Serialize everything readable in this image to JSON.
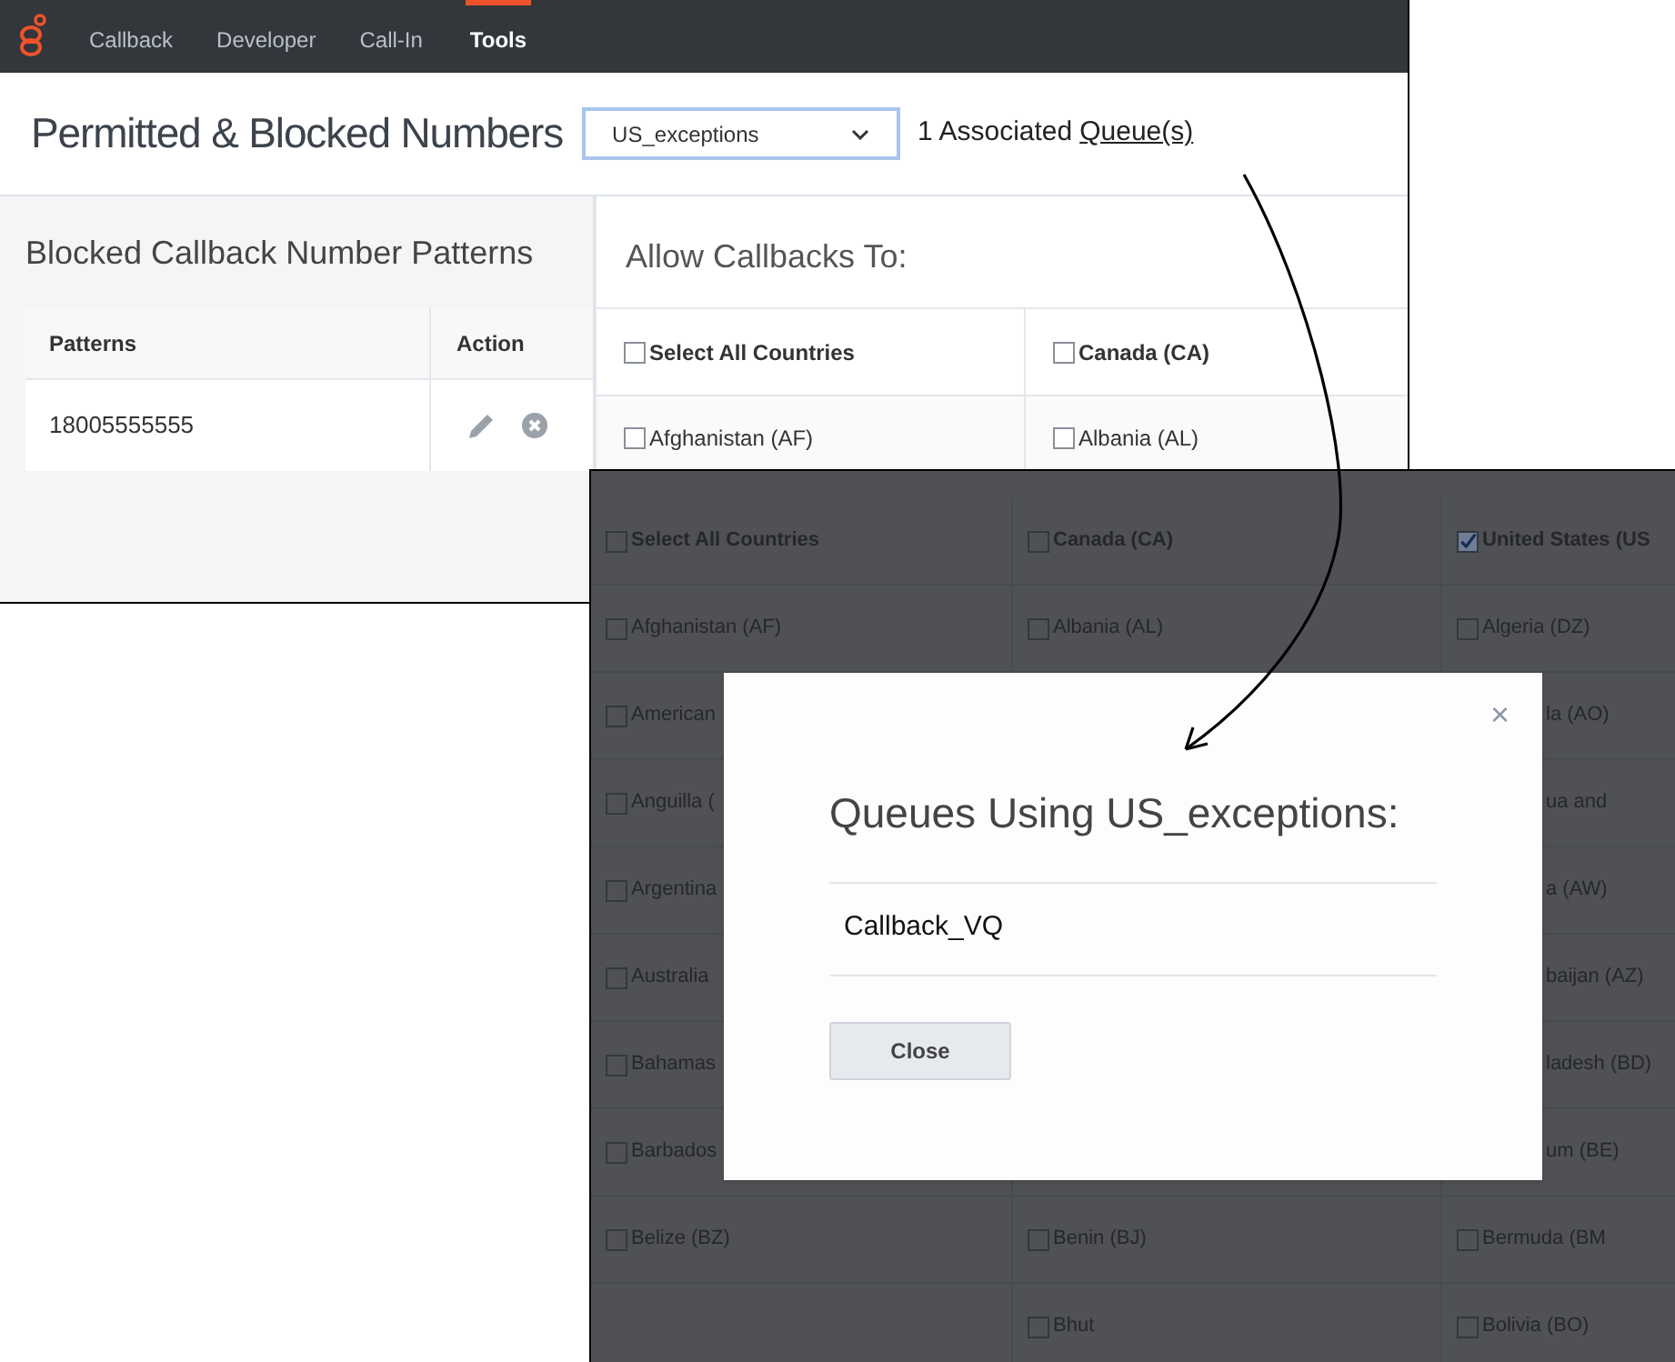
{
  "nav": {
    "items": [
      {
        "label": "Callback",
        "selected": false
      },
      {
        "label": "Developer",
        "selected": false
      },
      {
        "label": "Call-In",
        "selected": false
      },
      {
        "label": "Tools",
        "selected": true
      }
    ]
  },
  "header": {
    "title": "Permitted & Blocked Numbers",
    "dropdown": {
      "value": "US_exceptions"
    },
    "associated": "1 Associated",
    "queues_link": "Queue(s)"
  },
  "blocked": {
    "title": "Blocked Callback Number Patterns",
    "columns": [
      "Patterns",
      "Action"
    ],
    "rows": [
      {
        "pattern": "18005555555"
      }
    ]
  },
  "allow": {
    "title": "Allow Callbacks To:",
    "header": [
      {
        "label": "Select All Countries",
        "checked": false
      },
      {
        "label": "Canada (CA)",
        "checked": false
      }
    ],
    "rows": [
      [
        {
          "label": "Afghanistan (AF)",
          "checked": false
        },
        {
          "label": "Albania (AL)",
          "checked": false
        }
      ]
    ]
  },
  "overlay_grid": {
    "header": [
      {
        "label": "Select All Countries",
        "checked": false
      },
      {
        "label": "Canada (CA)",
        "checked": false
      },
      {
        "label": "United States (US",
        "checked": true
      }
    ],
    "rows": [
      [
        {
          "label": "Afghanistan (AF)",
          "checked": false
        },
        {
          "label": "Albania (AL)",
          "checked": false
        },
        {
          "label": "Algeria (DZ)",
          "checked": false
        }
      ],
      [
        {
          "label": "American",
          "checked": false
        },
        null,
        {
          "label": "la (AO)"
        }
      ],
      [
        {
          "label": "Anguilla (",
          "checked": false
        },
        null,
        {
          "label": "ua and"
        }
      ],
      [
        {
          "label": "Argentina",
          "checked": false
        },
        null,
        {
          "label": "a (AW)"
        }
      ],
      [
        {
          "label": "Australia",
          "checked": false
        },
        null,
        {
          "label": "baijan (AZ)"
        }
      ],
      [
        {
          "label": "Bahamas",
          "checked": false
        },
        null,
        {
          "label": "ladesh (BD)"
        }
      ],
      [
        {
          "label": "Barbados",
          "checked": false
        },
        null,
        {
          "label": "um (BE)"
        }
      ],
      [
        {
          "label": "Belize (BZ)",
          "checked": false
        },
        {
          "label": "Benin (BJ)",
          "checked": false
        },
        {
          "label": "Bermuda (BM",
          "checked": false
        }
      ],
      [
        null,
        {
          "label": "Bhut",
          "checked": false
        },
        {
          "label": "Bolivia (BO)",
          "checked": false
        }
      ]
    ]
  },
  "dialog": {
    "title": "Queues Using US_exceptions:",
    "close_glyph": "×",
    "queues": [
      "Callback_VQ"
    ],
    "button": "Close"
  }
}
